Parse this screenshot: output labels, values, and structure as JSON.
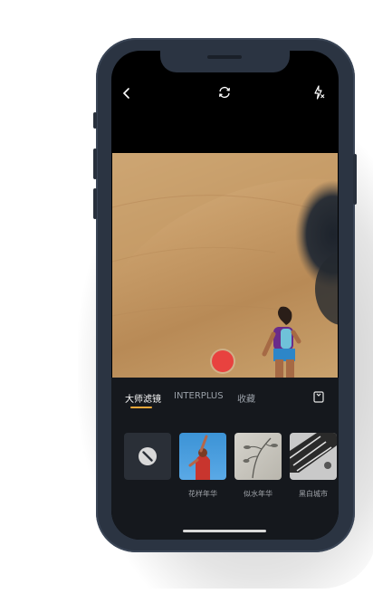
{
  "camera": {
    "top_bar": {
      "back_icon": "chevron-left-icon",
      "switch_camera_icon": "rotate-camera-icon",
      "flash_icon": "flash-off-icon"
    },
    "shutter_color": "#e8423f"
  },
  "filters": {
    "tabs": [
      {
        "label": "大师滤镜",
        "active": true
      },
      {
        "label": "INTERPLUS",
        "active": false
      },
      {
        "label": "收藏",
        "active": false
      }
    ],
    "tab_accent": "#f0a83a",
    "bookmark_icon": "bookmark-icon",
    "items": [
      {
        "label": "",
        "icon": "no-filter-icon"
      },
      {
        "label": "花样年华"
      },
      {
        "label": "似水年华"
      },
      {
        "label": "黑白城市"
      }
    ]
  }
}
